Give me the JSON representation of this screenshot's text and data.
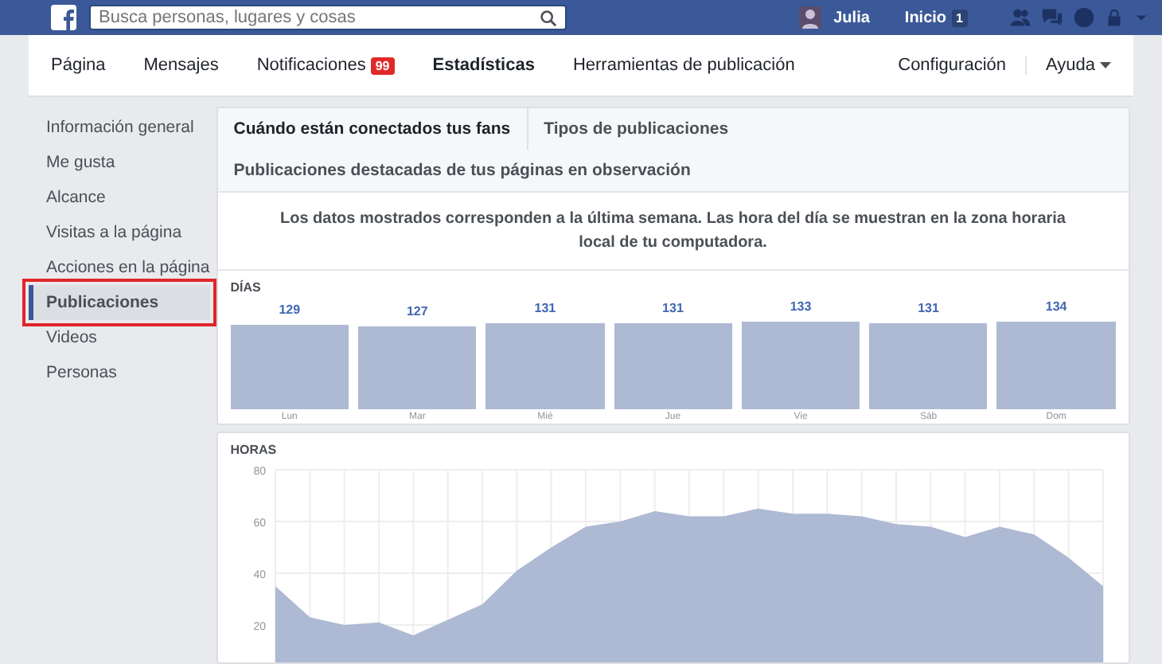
{
  "topbar": {
    "search": {
      "placeholder": "Busca personas, lugares y cosas"
    },
    "user": "Julia",
    "home": {
      "label": "Inicio",
      "badge": "1"
    }
  },
  "page_nav": {
    "items": [
      {
        "label": "Página",
        "selected": false
      },
      {
        "label": "Mensajes",
        "selected": false
      },
      {
        "label": "Notificaciones",
        "selected": false,
        "badge": "99"
      },
      {
        "label": "Estadísticas",
        "selected": true
      },
      {
        "label": "Herramientas de publicación",
        "selected": false
      }
    ],
    "right": [
      {
        "label": "Configuración",
        "kind": "link"
      },
      {
        "label": "Ayuda",
        "kind": "menu"
      }
    ]
  },
  "sidebar": {
    "items": [
      {
        "label": "Información general",
        "selected": false,
        "highlighted": false
      },
      {
        "label": "Me gusta",
        "selected": false,
        "highlighted": false
      },
      {
        "label": "Alcance",
        "selected": false,
        "highlighted": false
      },
      {
        "label": "Visitas a la página",
        "selected": false,
        "highlighted": false
      },
      {
        "label": "Acciones en la página",
        "selected": false,
        "highlighted": false
      },
      {
        "label": "Publicaciones",
        "selected": true,
        "highlighted": true
      },
      {
        "label": "Videos",
        "selected": false,
        "highlighted": false
      },
      {
        "label": "Personas",
        "selected": false,
        "highlighted": false
      }
    ]
  },
  "tabs": [
    {
      "label": "Cuándo están conectados tus fans",
      "selected": true
    },
    {
      "label": "Tipos de publicaciones",
      "selected": false
    },
    {
      "label": "Publicaciones destacadas de tus páginas en observación",
      "selected": false
    }
  ],
  "notice": "Los datos mostrados corresponden a la última semana. Las hora del día se muestran en la zona horaria local de tu computadora.",
  "days": {
    "title": "DÍAS",
    "chart_data": {
      "type": "bar",
      "categories": [
        "Lun",
        "Mar",
        "Mié",
        "Jue",
        "Vie",
        "Sáb",
        "Dom"
      ],
      "values": [
        129,
        127,
        131,
        131,
        133,
        131,
        134
      ],
      "data_labels": true
    }
  },
  "hours": {
    "title": "HORAS",
    "chart_data": {
      "type": "area",
      "grid": true,
      "series": [
        {
          "color": "#aeb9d4",
          "values": [
            35,
            23,
            20,
            21,
            16,
            22,
            28,
            41,
            50,
            58,
            60,
            64,
            62,
            62,
            65,
            63,
            63,
            62,
            59,
            58,
            54,
            58,
            55,
            46,
            35
          ]
        }
      ],
      "ylim": [
        0,
        80
      ],
      "yticks": [
        20,
        40,
        60,
        80
      ]
    }
  }
}
